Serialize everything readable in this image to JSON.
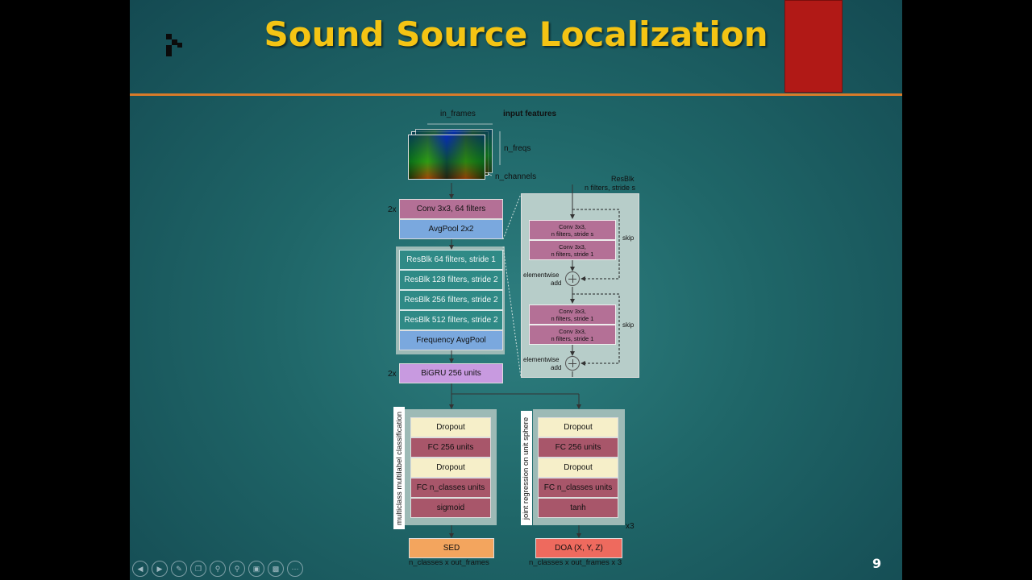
{
  "slide": {
    "title": "Sound Source Localization",
    "slide_number": "9",
    "controls": [
      "prev-icon",
      "next-icon",
      "pen-icon",
      "copy-icon",
      "zoom-icon",
      "search-icon",
      "screen-icon",
      "slideshow-icon",
      "more-icon"
    ]
  },
  "diagram": {
    "input": {
      "dim_in_frames": "in_frames",
      "heading": "input features",
      "dim_n_freqs": "n_freqs",
      "dim_n_channels": "n_channels"
    },
    "repeat_conv": "2x",
    "conv": "Conv 3x3, 64 filters",
    "avgpool": "AvgPool 2x2",
    "resblocks": [
      "ResBlk 64 filters, stride 1",
      "ResBlk 128 filters, stride 2",
      "ResBlk 256 filters, stride 2",
      "ResBlk 512 filters, stride 2"
    ],
    "freq_avgpool": "Frequency AvgPool",
    "repeat_gru": "2x",
    "bigru": "BiGRU 256 units",
    "resblk_detail": {
      "title_line1": "ResBlk",
      "title_line2": "n filters, stride s",
      "conv1_line1": "Conv 3x3,",
      "conv1_line2": "n filters, stride s",
      "conv2_line1": "Conv 3x3,",
      "conv2_line2": "n filters, stride 1",
      "conv3_line1": "Conv 3x3,",
      "conv3_line2": "n filters, stride 1",
      "conv4_line1": "Conv 3x3,",
      "conv4_line2": "n filters, stride 1",
      "skip1": "skip",
      "skip2": "skip",
      "add1_line1": "elementwise",
      "add1_line2": "add",
      "add2_line1": "elementwise",
      "add2_line2": "add"
    },
    "sed_head": {
      "label": "multiclass multilabel classification",
      "layers": [
        "Dropout",
        "FC 256 units",
        "Dropout",
        "FC n_classes units",
        "sigmoid"
      ],
      "output": "SED",
      "output_shape": "n_classes x out_frames"
    },
    "doa_head": {
      "label": "joint regression on unit sphere",
      "layers": [
        "Dropout",
        "FC 256 units",
        "Dropout",
        "FC n_classes units",
        "tanh"
      ],
      "repeat": "x3",
      "output": "DOA (X, Y, Z)",
      "output_shape": "n_classes x out_frames x 3"
    }
  },
  "colors": {
    "title": "#f4c414",
    "accent_rule": "#d87b2a",
    "red_block": "#b11916",
    "conv_pink": "#b47096",
    "pool_blue": "#7aa8de",
    "resblk_teal": "#2f8a86",
    "gru_violet": "#c89ae0",
    "dropout_cream": "#f6efc9",
    "fc_rose": "#a8566a",
    "sed_orange": "#f3a55e",
    "doa_red": "#ee6a5e"
  }
}
